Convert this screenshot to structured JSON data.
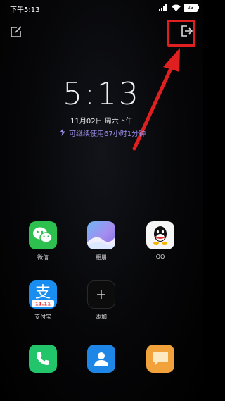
{
  "status_bar": {
    "time": "下午5:13",
    "battery": "23"
  },
  "clock": {
    "time": "5:13",
    "date": "11月02日 周六下午",
    "battery_estimate": "可继续使用67小时1分钟"
  },
  "apps": [
    {
      "label": "微信",
      "icon": "wechat-icon"
    },
    {
      "label": "相册",
      "icon": "gallery-icon"
    },
    {
      "label": "QQ",
      "icon": "qq-icon"
    },
    {
      "label": "支付宝",
      "icon": "alipay-icon",
      "badge": "11.11"
    },
    {
      "label": "添加",
      "icon": "plus-icon"
    }
  ],
  "dock": [
    {
      "icon": "phone-icon"
    },
    {
      "icon": "contacts-icon"
    },
    {
      "icon": "messages-icon"
    }
  ],
  "alipay_glyph": "支",
  "colors": {
    "highlight": "#e02020",
    "battery_text": "#9b8ce8"
  }
}
